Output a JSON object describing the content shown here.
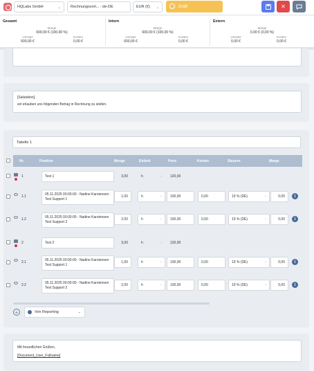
{
  "toolbar": {
    "company": "HQLabs GmbH",
    "template": "Rechnungsvorl... - de-DE",
    "currency": "EUR (€)",
    "status": "Draft",
    "colors": {
      "draft": "#f6c253",
      "save": "#5b7bf0",
      "close": "#e04a4a",
      "comment": "#6b7c93"
    }
  },
  "summary": {
    "labels": {
      "margin": "Marge",
      "revenue": "Umsatz",
      "costs": "Kosten"
    },
    "total": {
      "title": "Gesamt",
      "margin": "600,00 € (100,00 %)",
      "revenue": "600,00 €",
      "costs": "0,00 €"
    },
    "intern": {
      "title": "Intern",
      "margin": "600,00 € (100,00 %)",
      "revenue": "600,00 €",
      "costs": "0,00 €"
    },
    "extern": {
      "title": "Extern",
      "margin": "0,00 € (0,00 %)",
      "revenue": "0,00 €",
      "costs": "0,00 €"
    }
  },
  "intro": {
    "salutation": "[Salutation],",
    "text": "wir erlauben uns folgenden Betrag in Rechnung zu stellen."
  },
  "table": {
    "name": "Tabelle 1",
    "headers": [
      "Nr.",
      "Position",
      "Menge",
      "Einheit",
      "Preis",
      "Kosten",
      "Steuern",
      "Marge"
    ],
    "rows": [
      {
        "nr": "1",
        "position": "Test 1",
        "qty": "3,00",
        "unit": "h",
        "price": "120,00"
      },
      {
        "nr": "1.1",
        "position": "05.11.2025 00:00:00 - Nadine Karstensen Test Support 1",
        "qty": "1,00",
        "unit": "h",
        "price": "100,00",
        "costs": "0,00",
        "tax": "19 % (DE)",
        "margin": "0,00"
      },
      {
        "nr": "1.2",
        "position": "05.11.2025 00:00:00 - Nadine Karstensen Test Support 2",
        "qty": "2,00",
        "unit": "h",
        "price": "100,00",
        "costs": "0,00",
        "tax": "19 % (DE)",
        "margin": "0,00"
      },
      {
        "nr": "2",
        "position": "Test 2",
        "qty": "3,00",
        "unit": "h",
        "price": "120,00"
      },
      {
        "nr": "2.1",
        "position": "05.11.2025 00:00:00 - Nadine Karstensen Test Support 1",
        "qty": "1,00",
        "unit": "h",
        "price": "100,00",
        "costs": "0,00",
        "tax": "19 % (DE)",
        "margin": "0,00"
      },
      {
        "nr": "2.2",
        "position": "05.11.2025 00:00:00 - Nadine Karstensen Test Support 2",
        "qty": "2,00",
        "unit": "h",
        "price": "100,00",
        "costs": "0,00",
        "tax": "19 % (DE)",
        "margin": "0,00"
      }
    ],
    "add_source": "Von Reporting"
  },
  "closing": {
    "greeting": "Mit freundlichen Grüßen,",
    "signature": "[Document_User_Fullname]"
  }
}
